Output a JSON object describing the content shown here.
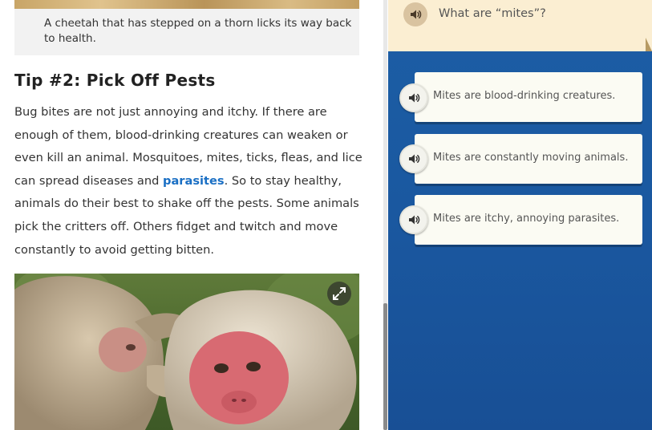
{
  "article": {
    "caption": "A cheetah that has stepped on a thorn licks its way back to health.",
    "heading": "Tip #2: Pick Off Pests",
    "paragraph_before_link": "Bug bites are not just annoying and itchy. If there are enough of them, blood-drinking creatures can weaken or even kill an animal. Mosquitoes, mites, ticks, fleas, and lice can spread diseases and ",
    "link_text": "parasites",
    "paragraph_after_link": ". So to stay healthy, animals do their best to shake off the pests. Some animals pick the critters off. Others fidget and twitch and move constantly to avoid getting bitten.",
    "photo_icon": "expand-icon"
  },
  "quiz": {
    "question": "What are “mites”?",
    "audio_icon": "speaker-icon",
    "answers": [
      {
        "label": "Mites are blood-drinking creatures."
      },
      {
        "label": "Mites are constantly moving animals."
      },
      {
        "label": "Mites are itchy, annoying parasites."
      }
    ]
  },
  "colors": {
    "link": "#1a6fc4",
    "quiz_background": "#1a58a0",
    "question_card": "#fbeed2",
    "answer_card": "#fbfbf3"
  }
}
